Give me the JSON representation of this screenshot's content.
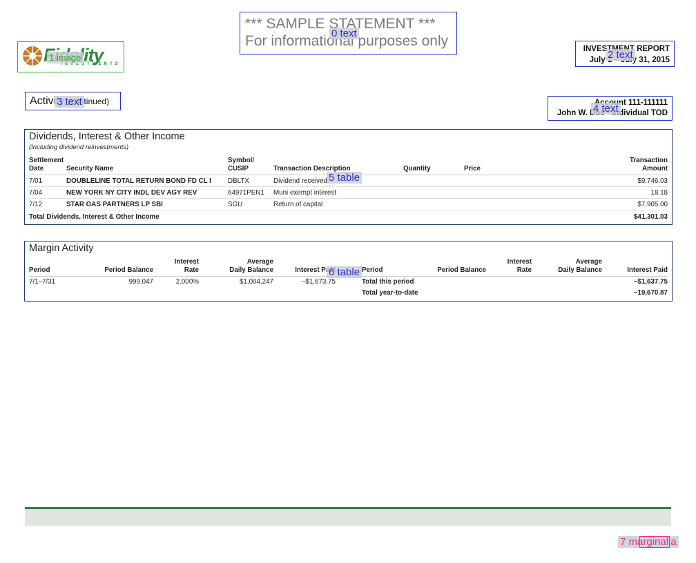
{
  "banner": {
    "line1": "*** SAMPLE STATEMENT ***",
    "line2": "For informational purposes only"
  },
  "logo": {
    "word": "Fidelity",
    "sub": "INVESTMENTS",
    "color": "#2e8b3e"
  },
  "report": {
    "title": "INVESTMENT REPORT",
    "period": "July 1 – July 31, 2015"
  },
  "activity": {
    "title": "Activity",
    "suffix": "(continued)"
  },
  "account": {
    "number": "Account 111-111111",
    "holder": "John W. Doe - Individual TOD"
  },
  "dividends": {
    "title": "Dividends, Interest & Other Income",
    "subtitle": "(Including dividend reinvestments)",
    "headers": {
      "date_1": "Settlement",
      "date_2": "Date",
      "security": "Security Name",
      "symbol_1": "Symbol/",
      "symbol_2": "CUSIP",
      "description": "Transaction Description",
      "quantity": "Quantity",
      "price": "Price",
      "amount_1": "Transaction",
      "amount_2": "Amount"
    },
    "rows": [
      {
        "date": "7/01",
        "security": "DOUBLELINE TOTAL RETURN BOND FD CL I",
        "symbol": "DBLTX",
        "description": "Dividend received",
        "quantity": "",
        "price": "",
        "amount": "$9,746.03"
      },
      {
        "date": "7/04",
        "security": "NEW YORK NY CITY INDL DEV AGY REV",
        "symbol": "64971PEN1",
        "description": "Muni exempt interest",
        "quantity": "",
        "price": "",
        "amount": "18.18"
      },
      {
        "date": "7/12",
        "security": "STAR GAS PARTNERS LP SBI",
        "symbol": "SGU",
        "description": "Return of capital",
        "quantity": "",
        "price": "",
        "amount": "$7,905.00"
      }
    ],
    "total_label": "Total Dividends, Interest & Other Income",
    "total_value": "$41,301.03"
  },
  "margin": {
    "title": "Margin Activity",
    "headers": {
      "period": "Period",
      "period_balance": "Period Balance",
      "rate_1": "Interest",
      "rate_2": "Rate",
      "avg_1": "Average",
      "avg_2": "Daily Balance",
      "paid": "Interest Paid",
      "period_r": "Period",
      "period_balance_r": "Period Balance",
      "rate_1_r": "Interest",
      "rate_2_r": "Rate",
      "avg_1_r": "Average",
      "avg_2_r": "Daily Balance",
      "paid_r": "Interest Paid"
    },
    "row": {
      "period": "7/1–7/31",
      "balance": "999,047",
      "rate": "2.000%",
      "avg": "$1,004,247",
      "paid": "−$1,673.75"
    },
    "summary": [
      {
        "label": "Total this period",
        "value": "−$1,637.75"
      },
      {
        "label": "Total year-to-date",
        "value": "−19,670.87"
      }
    ]
  },
  "overlay_tags": {
    "t0": "0 text",
    "t1": "1 image",
    "t2": "2 text",
    "t3": "3 text",
    "t4": "4 text",
    "t5": "5 table",
    "t6": "6 table",
    "t7": "7 marginalia"
  },
  "colors": {
    "annotation_text": "#2233cc",
    "annotation_image": "#33aa33",
    "annotation_marginalia": "#e0338a",
    "section_border": "#1f3f6a",
    "footer_rule": "#2e7d46"
  }
}
